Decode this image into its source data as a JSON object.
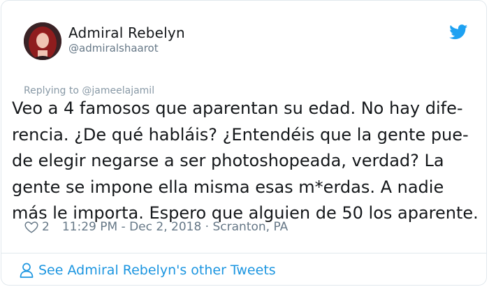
{
  "author": {
    "display_name": "Admiral Rebelyn",
    "handle": "@admiralshaarot"
  },
  "tweet": {
    "replying_prefix": "Replying to ",
    "replying_to": "@jameelajamil",
    "text_lines": [
      "Veo a 4 famosos que aparentan su edad. No hay dife-",
      "rencia. ¿De qué habláis? ¿Entendéis que la gente pue-",
      "de elegir negarse a ser photoshopeada, verdad? La",
      "gente se impone ella misma esas m*erdas. A nadie",
      "más le importa. Espero que alguien de 50 los aparente."
    ],
    "likes": "2",
    "timestamp": "11:29 PM - Dec 2, 2018",
    "separator": " · ",
    "location": "Scranton, PA"
  },
  "footer": {
    "link_label": "See Admiral Rebelyn's other Tweets"
  },
  "icons": {
    "brand": "twitter-bird-icon",
    "like": "heart-icon",
    "profile": "person-icon"
  },
  "colors": {
    "brand_blue": "#1da1f2",
    "link_blue": "#1b95e0",
    "muted_gray": "#657786",
    "text_dark": "#14171a",
    "border": "#e1e8ed"
  }
}
